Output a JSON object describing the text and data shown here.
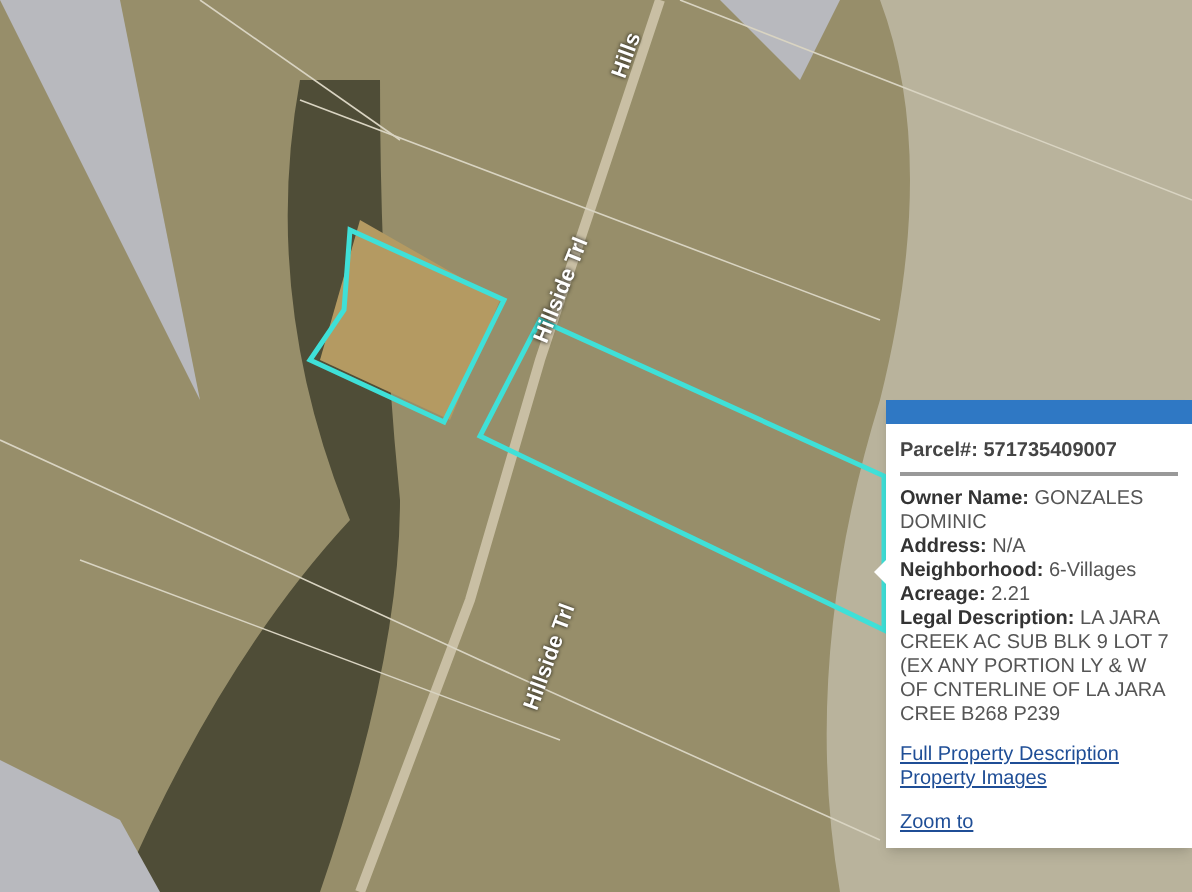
{
  "map": {
    "road_labels": [
      {
        "text": "Hills"
      },
      {
        "text": "Hillside Trl"
      },
      {
        "text": "Hillside Trl"
      }
    ]
  },
  "popup": {
    "parcel_label": "Parcel#:",
    "parcel_number": "571735409007",
    "fields": [
      {
        "label": "Owner Name:",
        "value": "GONZALES DOMINIC"
      },
      {
        "label": "Address:",
        "value": "N/A"
      },
      {
        "label": "Neighborhood:",
        "value": "6-Villages"
      },
      {
        "label": "Acreage:",
        "value": "2.21"
      },
      {
        "label": "Legal Description:",
        "value": "LA JARA CREEK AC SUB BLK 9 LOT 7 (EX ANY PORTION LY & W OF CNTERLINE OF LA JARA CREE B268 P239"
      }
    ],
    "links": [
      "Full Property Description",
      "Property Images"
    ],
    "zoom_link": "Zoom to"
  }
}
